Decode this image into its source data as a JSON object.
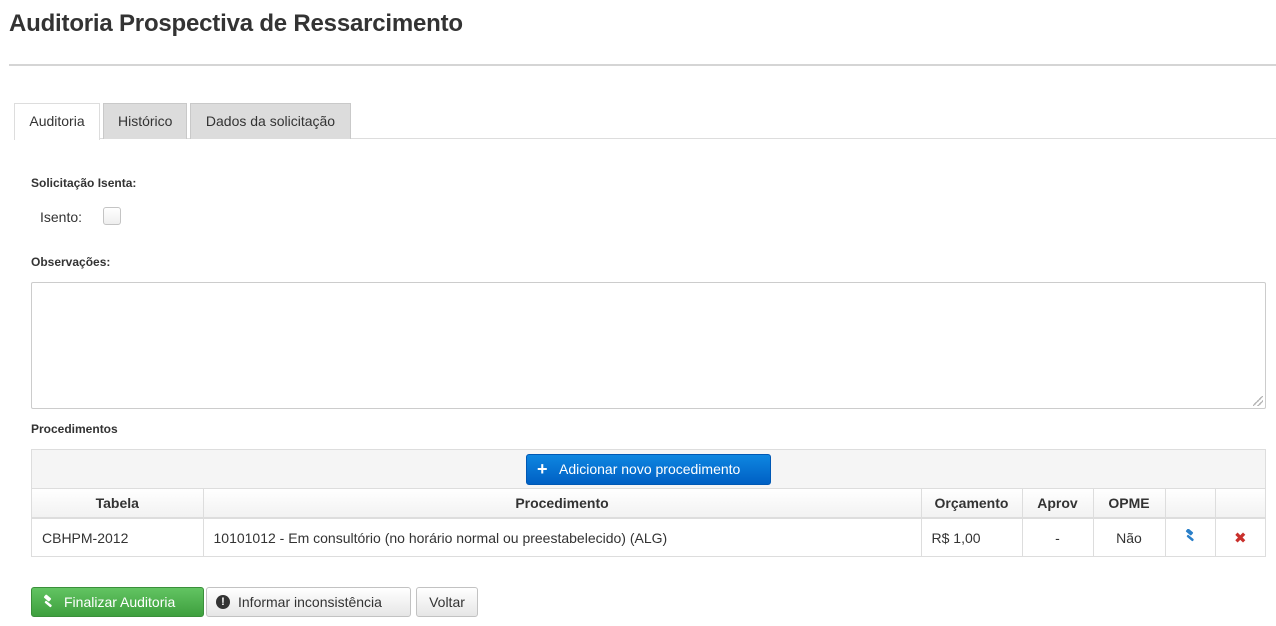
{
  "page": {
    "title": "Auditoria Prospectiva de Ressarcimento"
  },
  "tabs": [
    {
      "label": "Auditoria",
      "active": true
    },
    {
      "label": "Histórico",
      "active": false
    },
    {
      "label": "Dados da solicitação",
      "active": false
    }
  ],
  "solicitacao": {
    "section_label": "Solicitação Isenta:",
    "isento_label": "Isento:",
    "isento_checked": false
  },
  "observacoes": {
    "label": "Observações:",
    "value": ""
  },
  "procedimentos": {
    "label": "Procedimentos",
    "add_button_label": "Adicionar novo procedimento",
    "columns": [
      "Tabela",
      "Procedimento",
      "Orçamento",
      "Aprov",
      "OPME",
      "",
      ""
    ],
    "rows": [
      {
        "tabela": "CBHPM-2012",
        "procedimento": "10101012 - Em consultório (no horário normal ou preestabelecido) (ALG)",
        "orcamento": "R$ 1,00",
        "aprov": "-",
        "opme": "Não",
        "action_icon": "gavel-icon",
        "delete_icon": "remove-icon"
      }
    ]
  },
  "actions": {
    "finalizar_label": "Finalizar Auditoria",
    "inconsistencia_label": "Informar inconsistência",
    "voltar_label": "Voltar"
  },
  "colors": {
    "primary": "#0a73d6",
    "success": "#4cae4c",
    "danger": "#c9302c",
    "tab_inactive": "#dcdcdc"
  }
}
